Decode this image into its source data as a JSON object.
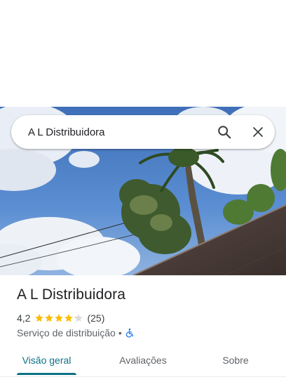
{
  "search": {
    "query": "A L Distribuidora",
    "search_icon": "search-icon",
    "close_icon": "close-icon"
  },
  "photo": {
    "icon": "place-photo"
  },
  "place": {
    "name": "A L Distribuidora",
    "rating": "4,2",
    "rating_value": 4.2,
    "stars_max": 5,
    "reviews_count": "(25)",
    "category": "Serviço de distribuição",
    "separator": "•",
    "accessibility_icon": "wheelchair-icon"
  },
  "tabs": [
    {
      "label": "Visão geral",
      "active": true
    },
    {
      "label": "Avaliações",
      "active": false
    },
    {
      "label": "Sobre",
      "active": false
    }
  ],
  "colors": {
    "accent": "#0b7285",
    "star": "#fbbc04",
    "star_empty": "#dadce0",
    "accessibility": "#1a73e8"
  }
}
